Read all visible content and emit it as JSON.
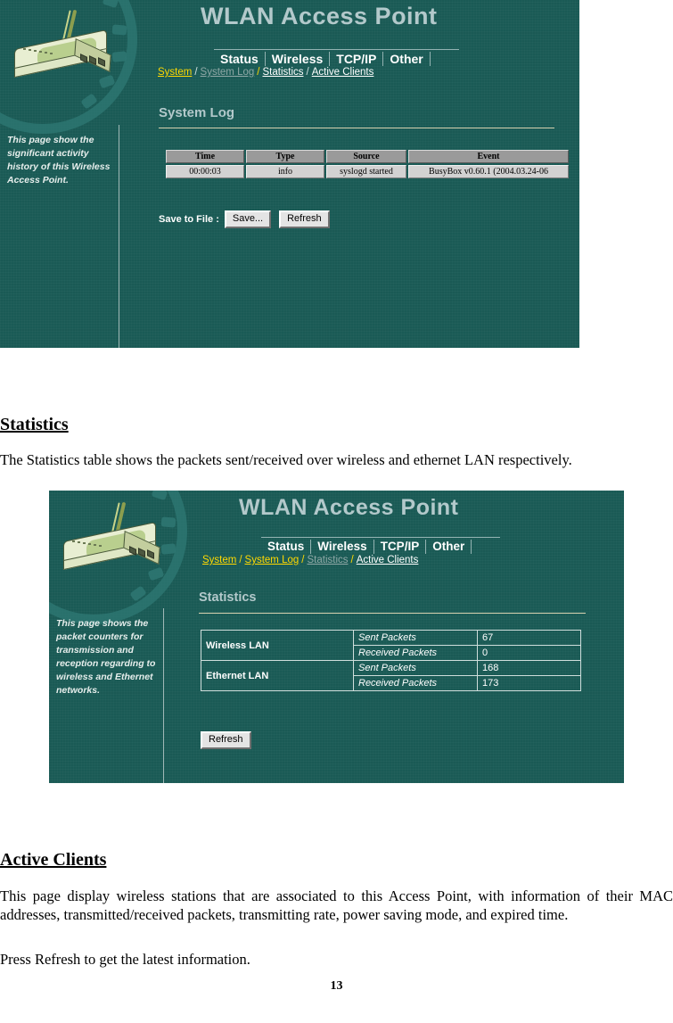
{
  "document": {
    "page_number": "13",
    "sections": [
      {
        "heading": "Statistics",
        "paragraphs": [
          "The Statistics table shows the packets sent/received over wireless and ethernet LAN respectively."
        ]
      },
      {
        "heading": "Active Clients",
        "paragraphs": [
          "This page display wireless stations that are associated to this Access Point, with information of their MAC addresses, transmitted/received packets, transmitting rate, power saving mode, and expired time.",
          "Press Refresh to get the latest information."
        ]
      }
    ]
  },
  "screenshot_system_log": {
    "app_title": "WLAN Access Point",
    "device_icon": "wireless-access-point-icon",
    "tabs": [
      {
        "label": "Status"
      },
      {
        "label": "Wireless"
      },
      {
        "label": "TCP/IP"
      },
      {
        "label": "Other"
      }
    ],
    "subnav": [
      {
        "label": "System",
        "state": "link"
      },
      {
        "label": "System Log",
        "state": "current"
      },
      {
        "label": "Statistics",
        "state": "plain"
      },
      {
        "label": "Active Clients",
        "state": "plain"
      }
    ],
    "subnav_separator": "/",
    "section_title": "System Log",
    "info_text": "This page show the significant activity history of this Wireless Access Point.",
    "table": {
      "columns": [
        "Time",
        "Type",
        "Source",
        "Event"
      ],
      "rows": [
        [
          "00:00:03",
          "info",
          "syslogd started",
          "BusyBox v0.60.1 (2004.03.24-06"
        ]
      ]
    },
    "save_to_file_label": "Save to File :",
    "save_button": "Save...",
    "refresh_button": "Refresh"
  },
  "screenshot_statistics": {
    "app_title": "WLAN Access Point",
    "device_icon": "wireless-access-point-icon",
    "tabs": [
      {
        "label": "Status"
      },
      {
        "label": "Wireless"
      },
      {
        "label": "TCP/IP"
      },
      {
        "label": "Other"
      }
    ],
    "subnav": [
      {
        "label": "System",
        "state": "link"
      },
      {
        "label": "System Log",
        "state": "link"
      },
      {
        "label": "Statistics",
        "state": "current"
      },
      {
        "label": "Active Clients",
        "state": "plain"
      }
    ],
    "subnav_separator": "/",
    "section_title": "Statistics",
    "info_text": "This page shows the packet counters for transmission and reception regarding to wireless and Ethernet networks.",
    "table": {
      "groups": [
        {
          "name": "Wireless LAN",
          "metrics": [
            {
              "label": "Sent Packets",
              "value": "67"
            },
            {
              "label": "Received Packets",
              "value": "0"
            }
          ]
        },
        {
          "name": "Ethernet LAN",
          "metrics": [
            {
              "label": "Sent Packets",
              "value": "168"
            },
            {
              "label": "Received Packets",
              "value": "173"
            }
          ]
        }
      ]
    },
    "refresh_button": "Refresh"
  },
  "colors": {
    "panel_background": "#1a5a55",
    "gear_accent": "#2d7571",
    "title_text": "#b3c9cb",
    "active_link": "#ffd900",
    "current_link": "#8fa8a6",
    "rule": "#d7d2b0",
    "table_header": "#9a9a9a",
    "table_cell": "#d2d2d2"
  }
}
